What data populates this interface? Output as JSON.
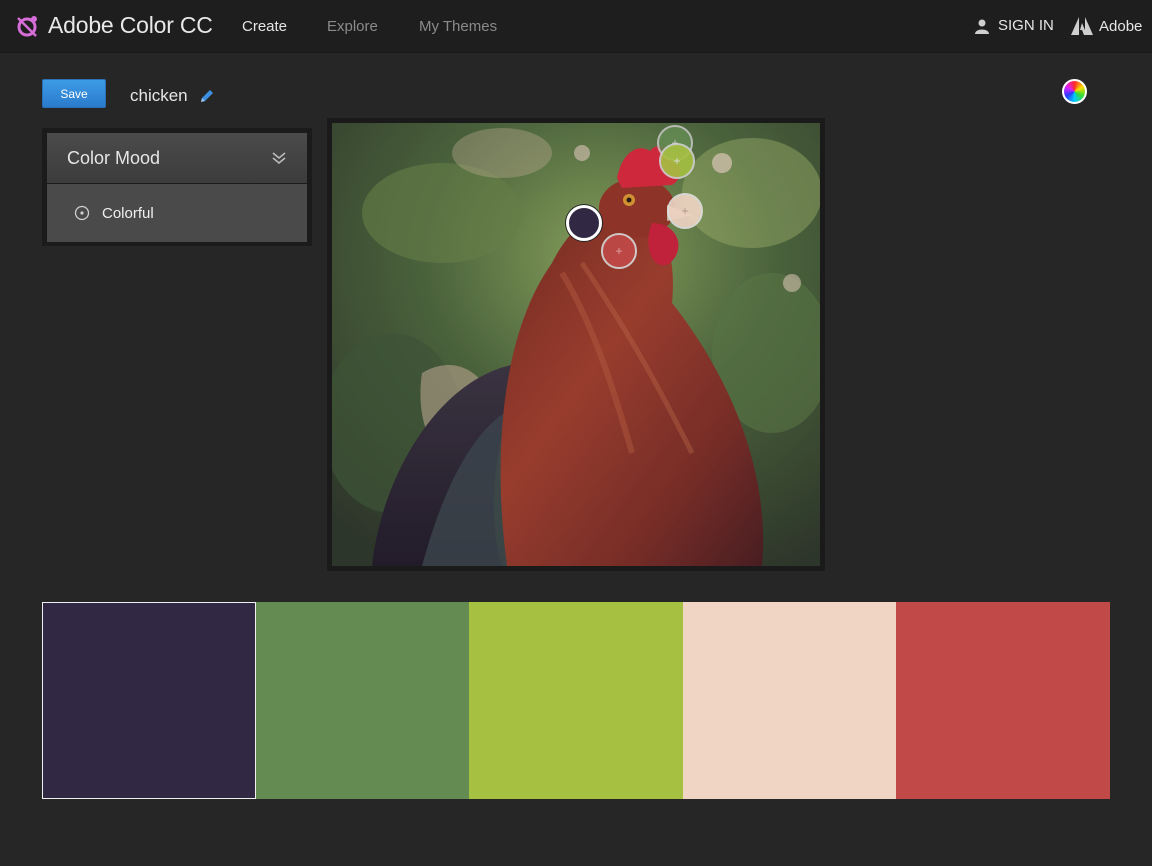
{
  "app": {
    "title": "Adobe Color CC",
    "logo_icon": "adobe-color-logo-icon"
  },
  "nav": {
    "links": [
      {
        "label": "Create",
        "active": true
      },
      {
        "label": "Explore",
        "active": false
      },
      {
        "label": "My Themes",
        "active": false
      }
    ],
    "sign_in": "SIGN IN",
    "adobe": "Adobe"
  },
  "toolbar": {
    "save_label": "Save",
    "theme_name": "chicken"
  },
  "mood": {
    "title": "Color Mood",
    "selected": "Colorful"
  },
  "swatches": [
    {
      "color": "#312843",
      "selected": true
    },
    {
      "color": "#648B52",
      "selected": false
    },
    {
      "color": "#A6C142",
      "selected": false
    },
    {
      "color": "#F0D4C4",
      "selected": false
    },
    {
      "color": "#C14947",
      "selected": false
    }
  ],
  "colors": {
    "accent": "#2F86D8",
    "background": "#262626"
  }
}
